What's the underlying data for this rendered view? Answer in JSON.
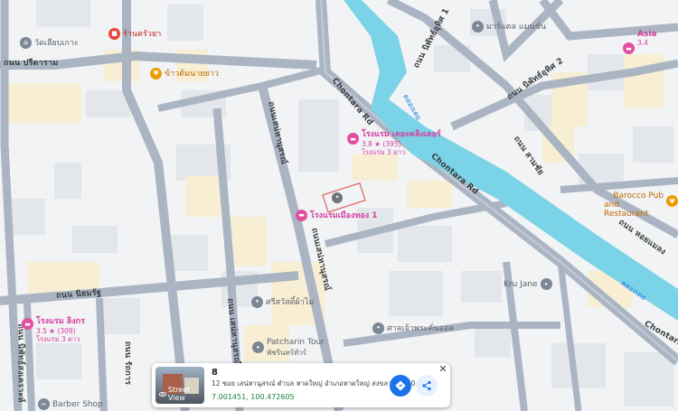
{
  "map": {
    "roads": {
      "chontara_upper": "Chontara Rd",
      "chontara_lower": "Chontara Rd",
      "chontara_bottom": "Chontara",
      "preedaram": "ถนน ปรีดาราม",
      "saen_hasarn_upper": "ถนนเสน่หานุสรณ์",
      "saen_hasarn_mid": "ถนนเสน่หานุสรณ์",
      "saen_hasarn_lower": "ถนน เสน่หานุสรณ์",
      "niphat_uthit_1": "ถนน นิพัทธ์อุทิศ 1",
      "niphat_songkhro": "ถนน นิพัทธ์สงเคราะห์",
      "ratthakan": "ถนน รัถการ",
      "nipat_uthit_right": "ถนน นิพัทธ์อุทิศ 2",
      "sam_chai": "ถนน สามชัย",
      "lower_right": "ถนน หอยแมลง",
      "niyom_rat": "ถนน นิยมรัฐ",
      "canal_upper": "คลองเตย",
      "canal_lower": "คลองเตย"
    },
    "pois": {
      "temple": "วัดเลียบเกาะ",
      "restaurant_top": "ร้านครัวยา",
      "restaurant_khao": "ข้าวต้มนายยาว",
      "hotel_top_name": "โรงแรม เดอะคลิงเลอร์",
      "hotel_top_rating": "3.8 ★ (395)",
      "hotel_top_class": "โรงแรม 3 ดาว",
      "hotel_center_name": "โรงแรมเมืองทอง 1",
      "hotel_left_name": "โรงแรม ลิงกร",
      "hotel_left_rating": "3.5 ★ (309)",
      "hotel_left_class": "โรงแรม 3 ดาว",
      "hotel_right_name": "Asia",
      "hotel_right_rating": "3.4",
      "market": "มาร์แตล แมนชั่น",
      "barocco_1": "Barocco Pub",
      "barocco_2": "and Restaurant",
      "kru_jane": "Kru Jane",
      "shrine": "ศาลเจ้าพระคั่นออค",
      "temple_lower": "ศรีสวัสดิ์ผ้าไม",
      "patcharin_1": "Patcharin Tour",
      "patcharin_2": "พัชรินทร์ทัวร์",
      "barber": "Barber Shop"
    },
    "selected_marker_icon": "place-pin-icon"
  },
  "card": {
    "title": "8",
    "address": "12 ซอย เสน่หานุสรณ์ ตำบล หาดใหญ่ อำเภอหาดใหญ่ สงขลา 90110",
    "coordinates": "7.001451, 100.472605",
    "street_view_label": "Street View",
    "close_label": "✕"
  },
  "colors": {
    "background": "#f1f3f4",
    "road": "#aab4c3",
    "canal": "#7ad3e6",
    "hotel_pin": "#e24ea1",
    "food_pin": "#f29900",
    "accent": "#1a73e8"
  }
}
